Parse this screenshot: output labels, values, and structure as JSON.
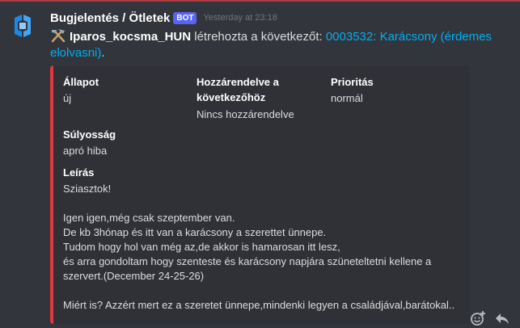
{
  "message": {
    "username": "Bugjelentés / Ötletek",
    "bot_tag": "BOT",
    "timestamp": "Yesterday at 23:18",
    "author": "Iparos_kocsma_HUN",
    "action_text": " létrehozta a következőt: ",
    "link_text": "0003532: Karácsony (érdemes elolvasni)",
    "trailing": ".",
    "hammer_icon": "hammer-pick-icon",
    "avatar_icon": "bug-tracker-logo-icon"
  },
  "embed": {
    "accent_color": "#e0383f",
    "fields": {
      "status_name": "Állapot",
      "status_value": "új",
      "assigned_name_line1": "Hozzárendelve a",
      "assigned_name_line2": "következőhöz",
      "assigned_value": "Nincs hozzárendelve",
      "priority_name": "Prioritás",
      "priority_value": "normál",
      "severity_name": "Súlyosság",
      "severity_value": "apró hiba",
      "description_name": "Leírás"
    },
    "description_lines": [
      "Sziasztok!",
      "",
      "Igen igen,még csak szeptember van.",
      "De kb 3hónap és itt van a karácsony a szerettet ünnepe.",
      "Tudom hogy hol van még az,de akkor is hamarosan itt lesz,",
      "és arra gondoltam hogy szenteste és karácsony napjára szüneteltetni kellene a",
      "szervert.(December 24-25-26)",
      "",
      "Miért is? Azzért mert ez a szeretet ünnepe,mindenki legyen a családjával,barátokal.."
    ]
  },
  "actions": {
    "add_reaction_icon": "add-reaction-icon",
    "reply_icon": "reply-icon"
  },
  "colors": {
    "background": "#32353b",
    "link": "#00aff4",
    "bot_tag": "#5865f2",
    "top_border": "#b03a3f"
  }
}
